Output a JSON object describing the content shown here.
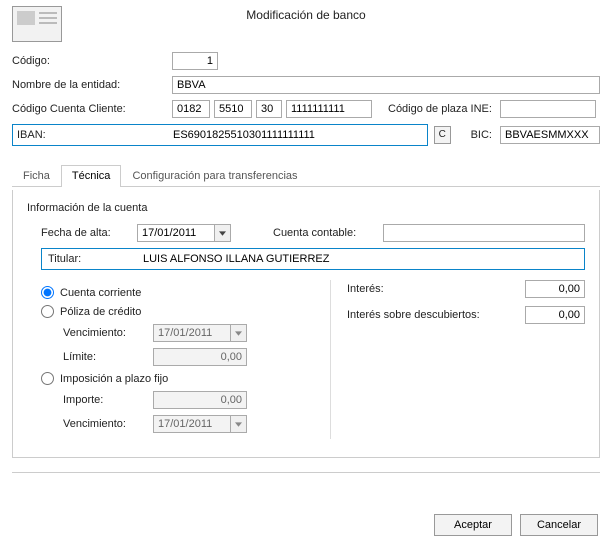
{
  "title": "Modificación de banco",
  "labels": {
    "codigo": "Código:",
    "nombre_entidad": "Nombre de la entidad:",
    "ccc": "Código Cuenta Cliente:",
    "plaza_ine": "Código de plaza INE:",
    "iban": "IBAN:",
    "bic": "BIC:",
    "c_btn": "C",
    "info_cuenta": "Información de la cuenta",
    "fecha_alta": "Fecha de alta:",
    "cuenta_contable": "Cuenta contable:",
    "titular": "Titular:",
    "cuenta_corriente": "Cuenta corriente",
    "poliza": "Póliza de crédito",
    "vencimiento": "Vencimiento:",
    "limite": "Límite:",
    "imposicion": "Imposición a plazo fijo",
    "importe": "Importe:",
    "interes": "Interés:",
    "interes_desc": "Interés sobre descubiertos:"
  },
  "vals": {
    "codigo": "1",
    "nombre_entidad": "BBVA",
    "ccc1": "0182",
    "ccc2": "5510",
    "ccc3": "30",
    "ccc4": "1111111111",
    "plaza_ine": "",
    "iban": "ES6901825510301111111111",
    "bic": "BBVAESMMXXX",
    "fecha_alta": "17/01/2011",
    "cuenta_contable": "",
    "titular": "LUIS ALFONSO ILLANA GUTIERREZ",
    "poliza_venc": "17/01/2011",
    "poliza_limite": "0,00",
    "imp_importe": "0,00",
    "imp_venc": "17/01/2011",
    "interes": "0,00",
    "interes_desc": "0,00"
  },
  "tabs": {
    "ficha": "Ficha",
    "tecnica": "Técnica",
    "config": "Configuración para transferencias"
  },
  "footer": {
    "accept": "Aceptar",
    "cancel": "Cancelar"
  },
  "account_type_selected": "corriente"
}
